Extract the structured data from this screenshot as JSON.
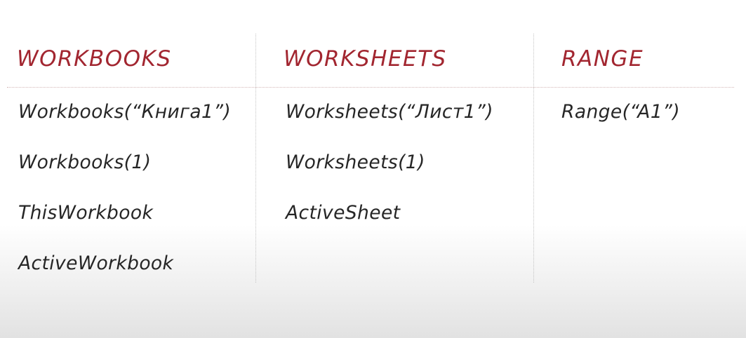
{
  "columns": [
    {
      "heading": "WORKBOOKS",
      "items": [
        "Workbooks(“Книга1”)",
        "Workbooks(1)",
        "ThisWorkbook",
        "ActiveWorkbook"
      ]
    },
    {
      "heading": "WORKSHEETS",
      "items": [
        "Worksheets(“Лист1”)",
        "Worksheets(1)",
        "ActiveSheet"
      ]
    },
    {
      "heading": "RANGE",
      "items": [
        "Range(“A1”)"
      ]
    }
  ],
  "colors": {
    "heading": "#a22630",
    "text": "#262626",
    "divider": "#c4c4c4"
  }
}
